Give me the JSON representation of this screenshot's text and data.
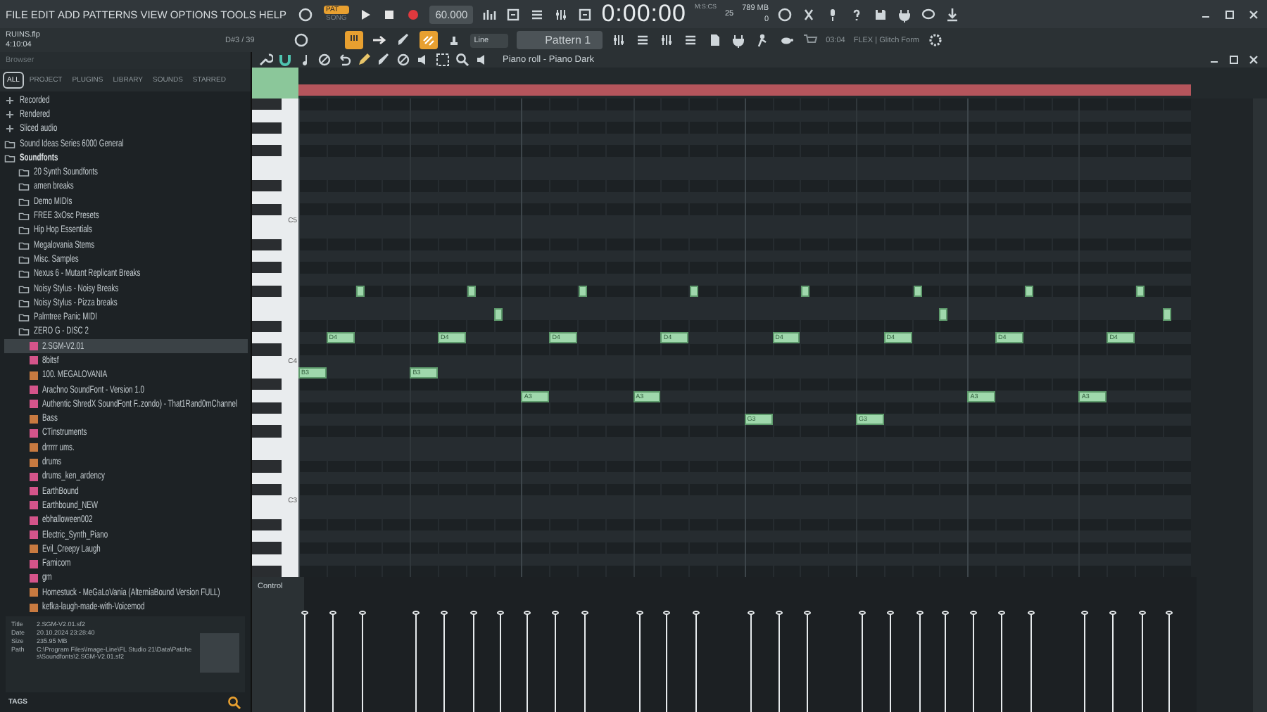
{
  "menu": [
    "FILE",
    "EDIT",
    "ADD",
    "PATTERNS",
    "VIEW",
    "OPTIONS",
    "TOOLS",
    "HELP"
  ],
  "transport": {
    "pat_label": "PAT",
    "song_label": "SONG",
    "pattern_mode": true,
    "tempo": "60.000",
    "time": "0:00:00",
    "time_unit": "M:S:CS",
    "cpu": "25",
    "memory": "789 MB",
    "polyphony": "0"
  },
  "project": {
    "file": "RUINS.flp",
    "length": "4:10:04",
    "hint": "D#3 / 39"
  },
  "snap": "Line",
  "pattern": "Pattern 1",
  "news": {
    "time": "03:04",
    "title": "FLEX | Glitch Form"
  },
  "browser": {
    "title": "Browser",
    "tabs": [
      {
        "label": "ALL",
        "selected": true
      },
      {
        "label": "PROJECT",
        "selected": false
      },
      {
        "label": "PLUGINS",
        "selected": false
      },
      {
        "label": "LIBRARY",
        "selected": false
      },
      {
        "label": "SOUNDS",
        "selected": false
      },
      {
        "label": "STARRED",
        "selected": false
      }
    ],
    "tree": [
      {
        "kind": "special",
        "label": "Recorded"
      },
      {
        "kind": "special",
        "label": "Rendered"
      },
      {
        "kind": "special",
        "label": "Sliced audio"
      },
      {
        "kind": "folder",
        "label": "Sound Ideas Series 6000 General",
        "expanded": false
      },
      {
        "kind": "folder",
        "label": "Soundfonts",
        "expanded": true,
        "children": [
          {
            "kind": "folder",
            "label": "20 Synth Soundfonts",
            "expanded": false
          },
          {
            "kind": "folder",
            "label": "amen breaks",
            "expanded": false
          },
          {
            "kind": "folder",
            "label": "Demo MIDIs",
            "expanded": false
          },
          {
            "kind": "folder",
            "label": "FREE 3xOsc Presets",
            "expanded": false
          },
          {
            "kind": "folder",
            "label": "Hip Hop Essentials",
            "expanded": false
          },
          {
            "kind": "folder",
            "label": "Megalovania Stems",
            "expanded": false
          },
          {
            "kind": "folder",
            "label": "Misc. Samples",
            "expanded": false
          },
          {
            "kind": "folder",
            "label": "Nexus 6 - Mutant Replicant Breaks",
            "expanded": false
          },
          {
            "kind": "folder",
            "label": "Noisy Stylus - Noisy Breaks",
            "expanded": false
          },
          {
            "kind": "folder",
            "label": "Noisy Stylus - Pizza breaks",
            "expanded": false
          },
          {
            "kind": "folder",
            "label": "Palmtree Panic MIDI",
            "expanded": false
          },
          {
            "kind": "folder",
            "label": "ZERO G - DISC 2",
            "expanded": false
          },
          {
            "kind": "file",
            "label": "2.SGM-V2.01",
            "color": "#d4548a",
            "selected": true
          },
          {
            "kind": "file",
            "label": "8bitsf",
            "color": "#d4548a",
            "selected": false
          },
          {
            "kind": "file",
            "label": "100. MEGALOVANIA",
            "color": "#c87a40",
            "selected": false
          },
          {
            "kind": "file",
            "label": "Arachno SoundFont - Version 1.0",
            "color": "#d4548a",
            "selected": false
          },
          {
            "kind": "file",
            "label": "Authentic ShredX SoundFont F..zondo) - That1Rand0mChannel",
            "color": "#d4548a",
            "selected": false
          },
          {
            "kind": "file",
            "label": "Bass",
            "color": "#c87a40",
            "selected": false
          },
          {
            "kind": "file",
            "label": "CTinstruments",
            "color": "#d4548a",
            "selected": false
          },
          {
            "kind": "file",
            "label": "drrrrr ums.",
            "color": "#c87a40",
            "selected": false
          },
          {
            "kind": "file",
            "label": "drums",
            "color": "#c87a40",
            "selected": false
          },
          {
            "kind": "file",
            "label": "drums_ken_ardency",
            "color": "#d4548a",
            "selected": false
          },
          {
            "kind": "file",
            "label": "EarthBound",
            "color": "#d4548a",
            "selected": false
          },
          {
            "kind": "file",
            "label": "Earthbound_NEW",
            "color": "#d4548a",
            "selected": false
          },
          {
            "kind": "file",
            "label": "ebhalloween002",
            "color": "#d4548a",
            "selected": false
          },
          {
            "kind": "file",
            "label": "Electric_Synth_Piano",
            "color": "#d4548a",
            "selected": false
          },
          {
            "kind": "file",
            "label": "Evil_Creepy Laugh",
            "color": "#c87a40",
            "selected": false
          },
          {
            "kind": "file",
            "label": "Famicom",
            "color": "#d4548a",
            "selected": false
          },
          {
            "kind": "file",
            "label": "gm",
            "color": "#d4548a",
            "selected": false
          },
          {
            "kind": "file",
            "label": "Homestuck - MeGaLoVania (AlterniaBound Version FULL)",
            "color": "#c87a40",
            "selected": false
          },
          {
            "kind": "file",
            "label": "kefka-laugh-made-with-Voicemod",
            "color": "#c87a40",
            "selected": false
          }
        ]
      }
    ],
    "info": [
      {
        "key": "Title",
        "value": "2.SGM-V2.01.sf2"
      },
      {
        "key": "Date",
        "value": "20.10.2024 23:28:40"
      },
      {
        "key": "Size",
        "value": "235.95 MB"
      },
      {
        "key": "Path",
        "value": "C:\\Program Files\\Image-Line\\FL Studio 21\\Data\\Patches\\Soundfonts\\2.SGM-V2.01.sf2"
      }
    ],
    "tags_label": "TAGS"
  },
  "piano_roll": {
    "title": "Piano roll - Piano Dark",
    "key_labels": [
      "C5",
      "C4",
      "C3"
    ],
    "control_label": "Control",
    "notes": [
      {
        "label": "B3"
      },
      {
        "label": "D4"
      },
      {
        "label": "B3"
      },
      {
        "label": "D4"
      },
      {
        "label": "A3"
      },
      {
        "label": "D4"
      },
      {
        "label": "A3"
      },
      {
        "label": "D4"
      },
      {
        "label": "G3"
      },
      {
        "label": "D4"
      },
      {
        "label": "G3"
      },
      {
        "label": "D4"
      },
      {
        "label": "A3"
      },
      {
        "label": "D4"
      },
      {
        "label": "A3"
      },
      {
        "label": "D4"
      }
    ]
  }
}
